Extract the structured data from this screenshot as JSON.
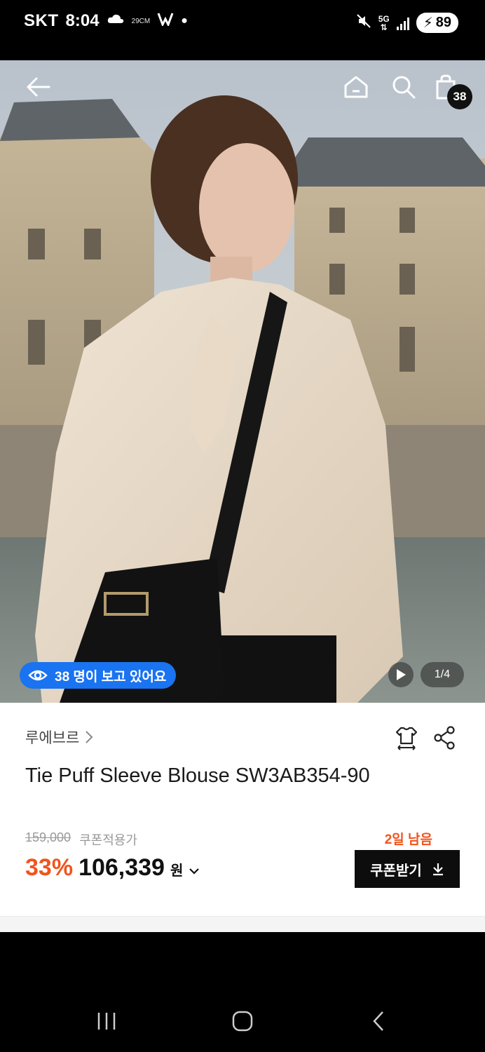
{
  "status_bar": {
    "carrier": "SKT",
    "time": "8:04",
    "temp": "29CM",
    "network": "5G",
    "battery": "89"
  },
  "topnav": {
    "cart_count": "38"
  },
  "hero": {
    "viewers_text": "38 명이 보고 있어요",
    "image_counter": "1/4"
  },
  "product": {
    "brand": "루에브르",
    "title": "Tie Puff Sleeve Blouse SW3AB354-90",
    "original_price": "159,000",
    "coupon_label": "쿠폰적용가",
    "discount": "33%",
    "sale_price": "106,339",
    "currency": "원",
    "days_left": "2일 남음",
    "coupon_button": "쿠폰받기"
  },
  "colors": {
    "accent_orange": "#f0541e",
    "viewer_blue": "#1a73f0",
    "dark": "#0d0d0d"
  },
  "icons": [
    "back-arrow-icon",
    "home-icon",
    "search-icon",
    "cart-icon",
    "eye-icon",
    "play-icon",
    "size-guide-icon",
    "share-icon",
    "chevron-right-icon",
    "chevron-down-icon",
    "download-icon",
    "recents-icon",
    "home-nav-icon",
    "back-nav-icon"
  ]
}
